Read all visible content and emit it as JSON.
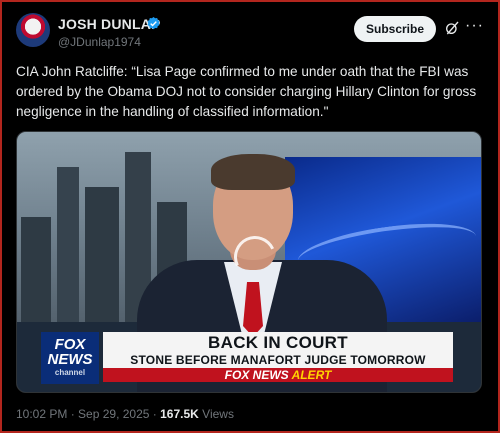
{
  "author": {
    "display_name": "JOSH DUNLAP",
    "handle": "@JDunlap1974",
    "verified_icon": "verified-badge-icon"
  },
  "actions": {
    "subscribe_label": "Subscribe",
    "grok_icon": "grok-icon",
    "more_label": "···"
  },
  "tweet": {
    "text": "CIA John Ratcliffe: “Lisa Page confirmed to me under oath that the FBI was ordered by the Obama DOJ not to consider charging Hillary Clinton for gross negligence in the handling of classified information.\""
  },
  "video": {
    "network_logo_line1": "FOX",
    "network_logo_line2": "NEWS",
    "network_logo_line3": "channel",
    "headline": "BACK IN COURT",
    "subheadline": "STONE BEFORE MANAFORT JUDGE TOMORROW",
    "alert_brand": "FOX NEWS",
    "alert_word": "ALERT"
  },
  "meta": {
    "time": "10:02 PM",
    "separator": " · ",
    "date": "Sep 29, 2025",
    "views_count": "167.5K",
    "views_label": " Views"
  },
  "colors": {
    "background": "#000000",
    "subscribe_bg": "#eff3f4",
    "verified": "#1d9bf0",
    "alert_red": "#c0121e"
  }
}
